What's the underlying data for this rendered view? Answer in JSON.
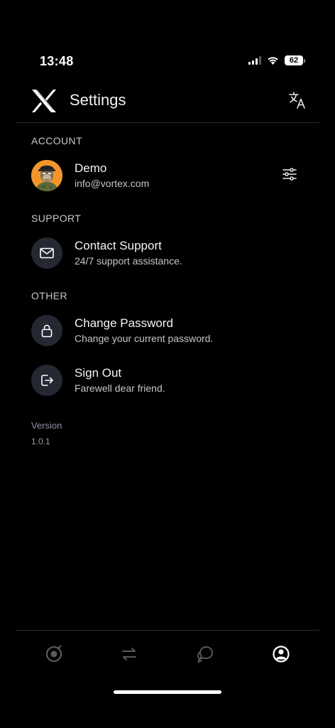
{
  "status_bar": {
    "time": "13:48",
    "battery": "62"
  },
  "header": {
    "title": "Settings"
  },
  "sections": {
    "account": "ACCOUNT",
    "support": "SUPPORT",
    "other": "OTHER"
  },
  "account": {
    "name": "Demo",
    "email": "info@vortex.com"
  },
  "support": {
    "title": "Contact Support",
    "subtitle": "24/7 support assistance."
  },
  "change_password": {
    "title": "Change Password",
    "subtitle": "Change your current password."
  },
  "sign_out": {
    "title": "Sign Out",
    "subtitle": "Farewell dear friend."
  },
  "version": {
    "label": "Version",
    "value": "1.0.1"
  },
  "icons": {
    "logo": "vortex-x-logo",
    "translate": "translate-icon",
    "account_settings": "sliders-icon",
    "support": "mail-icon",
    "password": "lock-icon",
    "sign_out": "sign-out-icon",
    "tabs": [
      "target-icon",
      "swap-arrows-icon",
      "chat-bubbles-icon",
      "user-profile-icon"
    ]
  },
  "colors": {
    "background": "#000000",
    "icon_bg": "#252733",
    "avatar_bg": "#f2962b",
    "active_tab": "#ffffff",
    "inactive_tab": "#555555"
  }
}
